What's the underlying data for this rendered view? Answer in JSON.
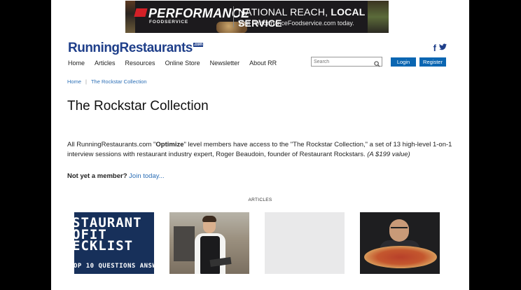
{
  "ad": {
    "brand": "PERFORMANCE",
    "brand_sub": "FOODSERVICE",
    "headline_regular": "NATIONAL REACH, ",
    "headline_bold": "LOCAL SERVICE",
    "subline": "Visit PerformanceFoodservice.com today."
  },
  "header": {
    "logo": "RunningRestaurants",
    "logo_suffix": ".com",
    "search_placeholder": "Search",
    "login_label": "Login",
    "register_label": "Register"
  },
  "nav": [
    "Home",
    "Articles",
    "Resources",
    "Online Store",
    "Newsletter",
    "About RR"
  ],
  "breadcrumb": {
    "home": "Home",
    "current": "The Rockstar Collection"
  },
  "page": {
    "title": "The Rockstar Collection",
    "intro_1": "All RunningRestaurants.com \"",
    "intro_bold": "Optimize",
    "intro_2": "\" level members have access to the \"The Rockstar Collection,\" a set of 13 high-level 1-on-1 interview sessions with restaurant industry expert, Roger Beaudoin, founder of Restaurant Rockstars. ",
    "intro_italic": "(A $199 value)",
    "cta_text": "Not yet a member?",
    "cta_link": "Join today..."
  },
  "articles": {
    "label": "ARTICLES",
    "card1_lines": [
      "STAURANT",
      "OFIT",
      "ECKLIST",
      "OP 10 QUESTIONS ANSW"
    ]
  }
}
